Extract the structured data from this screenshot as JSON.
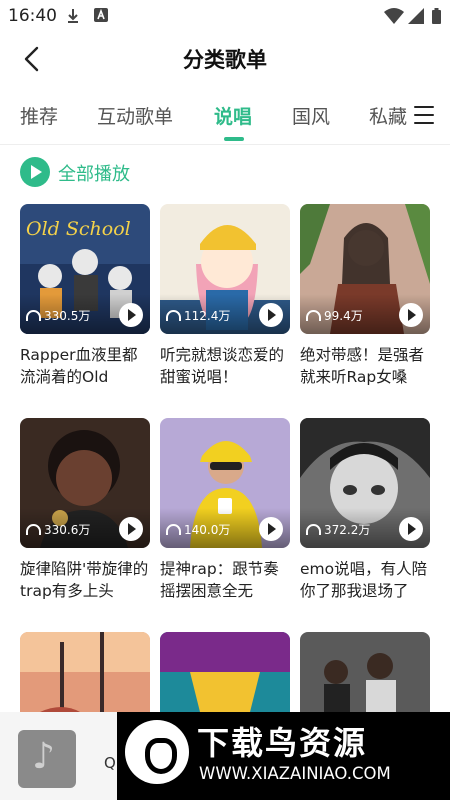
{
  "status_bar": {
    "time": "16:40",
    "icons": [
      "download-icon",
      "a-box-icon",
      "wifi-icon",
      "signal-icon",
      "battery-icon"
    ]
  },
  "header": {
    "title": "分类歌单",
    "back_icon": "back-arrow-icon"
  },
  "tabs": [
    {
      "label": "推荐",
      "active": false
    },
    {
      "label": "互动歌单",
      "active": false
    },
    {
      "label": "说唱",
      "active": true
    },
    {
      "label": "国风",
      "active": false
    },
    {
      "label": "私藏",
      "active": false
    }
  ],
  "menu_icon": "menu-icon",
  "play_all": {
    "label": "全部播放"
  },
  "accent_color": "#2fbb8a",
  "playlists": [
    {
      "plays": "330.5万",
      "title": "Rapper血液里都流淌着的Old",
      "cover_text": "Old School",
      "cover_color": "#2d4a7a"
    },
    {
      "plays": "112.4万",
      "title": "听完就想谈恋爱的甜蜜说唱！",
      "cover_text": "",
      "cover_color": "#f2ece0"
    },
    {
      "plays": "99.4万",
      "title": "绝对带感！是强者就来听Rap女嗓",
      "cover_text": "",
      "cover_color": "#c9a896"
    },
    {
      "plays": "330.6万",
      "title": "旋律陷阱'带旋律的trap有多上头",
      "cover_text": "",
      "cover_color": "#3a2a22"
    },
    {
      "plays": "140.0万",
      "title": "提神rap：跟节奏摇摆困意全无",
      "cover_text": "",
      "cover_color": "#b7a9d6"
    },
    {
      "plays": "372.2万",
      "title": "emo说唱，有人陪你了那我退场了",
      "cover_text": "",
      "cover_color": "#6f6f6f"
    },
    {
      "plays": "",
      "title": "",
      "cover_text": "",
      "cover_color": "#e39a7a"
    },
    {
      "plays": "",
      "title": "",
      "cover_text": "",
      "cover_color": "#1d8a9a"
    },
    {
      "plays": "",
      "title": "",
      "cover_text": "",
      "cover_color": "#5a5a5a"
    }
  ],
  "mini_player": {
    "title": "Q"
  },
  "watermark": {
    "text": "下载鸟资源",
    "url": "WWW.XIAZAINIAO.COM"
  }
}
